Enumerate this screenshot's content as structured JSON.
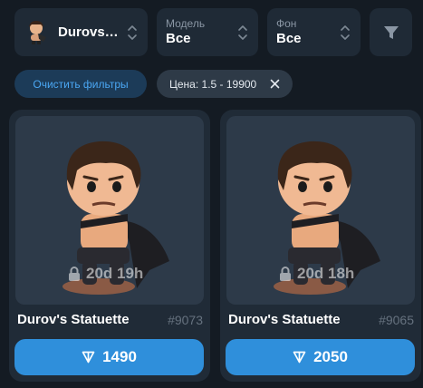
{
  "filters": {
    "collection": {
      "name": "Durovs…"
    },
    "model": {
      "label": "Модель",
      "value": "Все"
    },
    "background": {
      "label": "Фон",
      "value": "Все"
    }
  },
  "chips": {
    "clear_label": "Очистить фильтры",
    "price_label": "Цена: 1.5 - 19900"
  },
  "cards": [
    {
      "title": "Durov's Statuette",
      "number": "#9073",
      "timer": "20d 19h",
      "price": "1490"
    },
    {
      "title": "Durov's Statuette",
      "number": "#9065",
      "timer": "20d 18h",
      "price": "2050"
    }
  ],
  "colors": {
    "background": "#141b23",
    "panel": "#1f2a36",
    "accent": "#2f8fdb",
    "chip_clear_bg": "#1c3b58",
    "chip_clear_text": "#4aa6f2"
  },
  "icons": [
    "collection-thumbnail",
    "chevron-updown-icon",
    "filter-funnel-icon",
    "close-icon",
    "lock-icon",
    "ton-diamond-icon"
  ]
}
